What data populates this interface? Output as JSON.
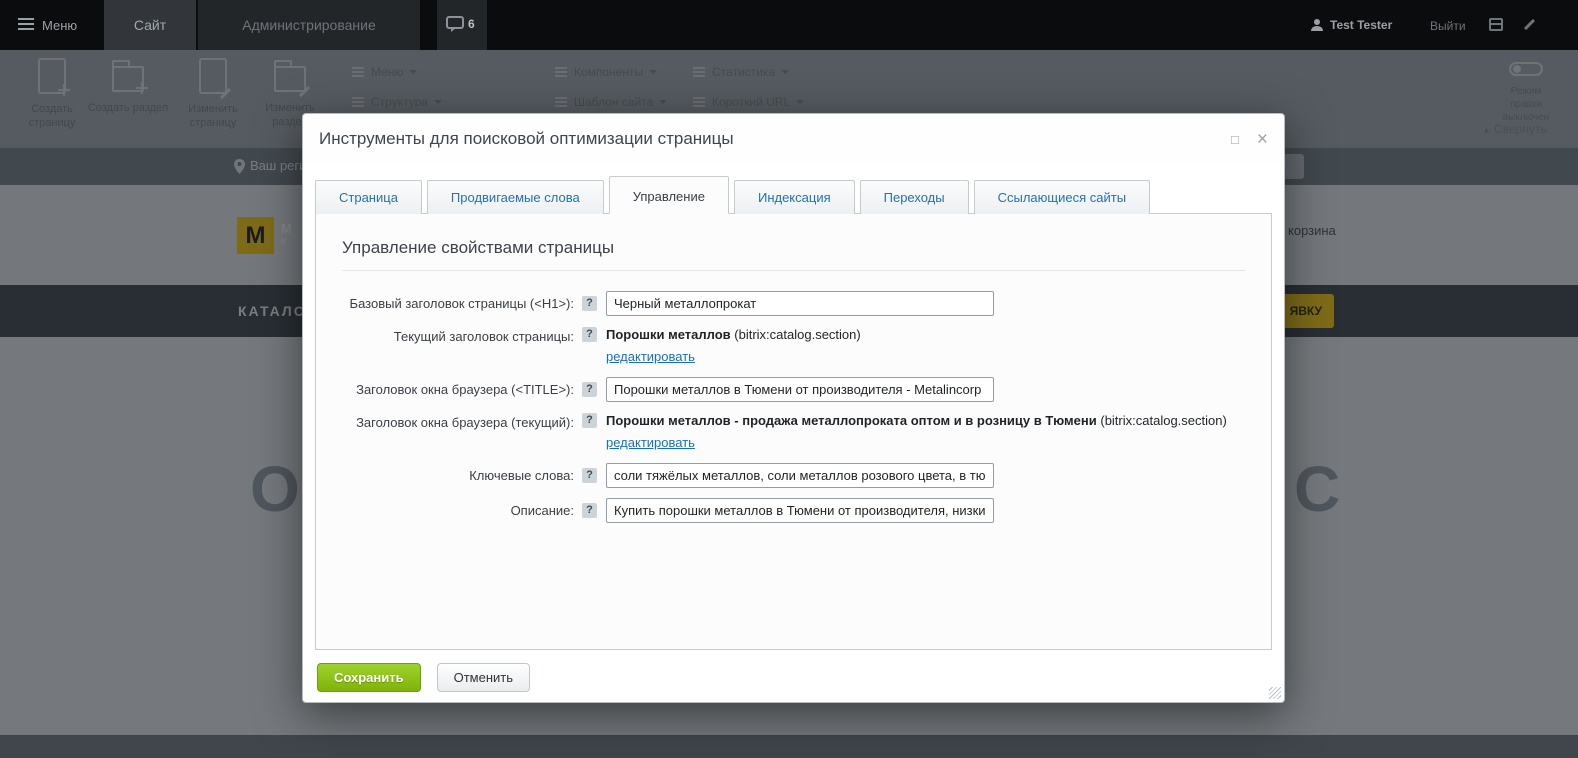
{
  "colors": {
    "save_button_green": "#8cbe0f",
    "link_blue": "#1a6fba",
    "brand_yellow": "#f6cd22"
  },
  "icons": {
    "help": "?",
    "refresh": "↻",
    "collapse_arrow": "▴",
    "maximize": "□",
    "close": "×"
  },
  "topbar": {
    "menu_label": "Меню",
    "site_tab": "Сайт",
    "admin_tab": "Администрирование",
    "chat_count": "6",
    "user_name": "Test Tester",
    "logout_label": "Выйти"
  },
  "toolbar": {
    "actions": [
      {
        "label": "Создать страницу"
      },
      {
        "label": "Создать раздел"
      },
      {
        "label": "Изменить страницу"
      },
      {
        "label": "Изменить раздел"
      }
    ],
    "menu_groups": [
      [
        "Меню",
        "Структура"
      ],
      [
        "Компоненты",
        "Шаблон сайта"
      ],
      [
        "Статистика",
        "Короткий URL"
      ]
    ],
    "edit_mode_line1": "Режим правки",
    "edit_mode_line2": "выключен",
    "collapse_label": "Свернуть"
  },
  "page": {
    "region_label": "Ваш регион",
    "logo_letter": "М",
    "site_name_fragment_top": "М",
    "site_name_fragment_bottom": "К",
    "cart_label": "корзина",
    "catalog_label": "КАТАЛОГ",
    "cta_fragment": "ЯВКУ",
    "big_title_fragment_left": "ОО",
    "big_title_fragment_right": "С"
  },
  "modal": {
    "title": "Инструменты для поисковой оптимизации страницы",
    "tabs": [
      {
        "label": "Страница"
      },
      {
        "label": "Продвигаемые слова"
      },
      {
        "label": "Управление"
      },
      {
        "label": "Индексация"
      },
      {
        "label": "Переходы"
      },
      {
        "label": "Ссылающиеся сайты"
      }
    ],
    "section_title": "Управление свойствами страницы",
    "fields": {
      "h1": {
        "label": "Базовый заголовок страницы (<H1>):",
        "value": "Черный металлопрокат"
      },
      "current_title": {
        "label": "Текущий заголовок страницы:",
        "value_bold": "Порошки металлов",
        "value_suffix": " (bitrix:catalog.section)",
        "edit_link": "редактировать"
      },
      "browser_title": {
        "label": "Заголовок окна браузера (<TITLE>):",
        "value": "Порошки металлов в Тюмени от производителя - Metalincorp"
      },
      "browser_title_current": {
        "label": "Заголовок окна браузера (текущий):",
        "value_bold": "Порошки металлов - продажа металлопроката оптом и в розницу в Тюмени",
        "value_suffix": " (bitrix:catalog.section)",
        "edit_link": "редактировать"
      },
      "keywords": {
        "label": "Ключевые слова:",
        "value": "соли тяжёлых металлов, соли металлов розового цвета, в тюм"
      },
      "description": {
        "label": "Описание:",
        "value": "Купить порошки металлов в Тюмени от производителя, низкие"
      }
    },
    "buttons": {
      "save": "Сохранить",
      "cancel": "Отменить"
    }
  }
}
